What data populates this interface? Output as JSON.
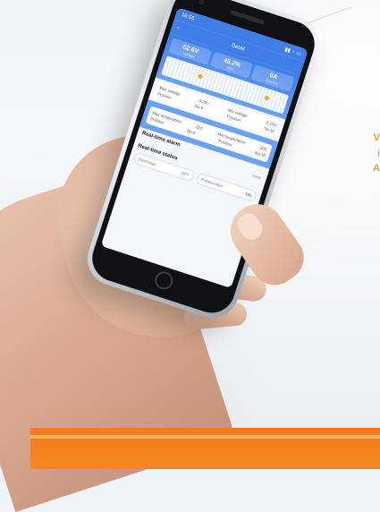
{
  "phone": {
    "status_time": "16:55",
    "app_title": "Detail",
    "back_icon": "chevron-left-icon",
    "stats": [
      {
        "value": "52.6V",
        "label": "Voltage"
      },
      {
        "value": "45.2%",
        "label": "SOC"
      },
      {
        "value": "0A",
        "label": "Current"
      }
    ],
    "cell_voltage": {
      "max_label": "Max voltage",
      "max_value": "3.29V",
      "min_label": "Min voltage",
      "min_value": "3.27V",
      "max_position_label": "Position",
      "max_position": "No.6",
      "min_position_label": "Position",
      "min_position": "No.11"
    },
    "temperature": {
      "max_label": "Max temperature",
      "max_value": "22C",
      "min_label": "Min temperature",
      "min_value": "20C",
      "max_position_label": "Position",
      "max_position": "No.6",
      "min_position_label": "Position",
      "min_position": "No.10"
    },
    "realtime_alarm_title": "Real-time alarm",
    "realtime_alarm_value": "none",
    "realtime_status_title": "Real-time status",
    "toggles": [
      {
        "label": "Discharge",
        "value": "OFF"
      },
      {
        "label": "Positivestate",
        "value": "ON"
      }
    ]
  },
  "colors": {
    "accent_blue": "#3f7de8",
    "accent_orange": "#f47a1f",
    "status_on": "#28a745"
  }
}
